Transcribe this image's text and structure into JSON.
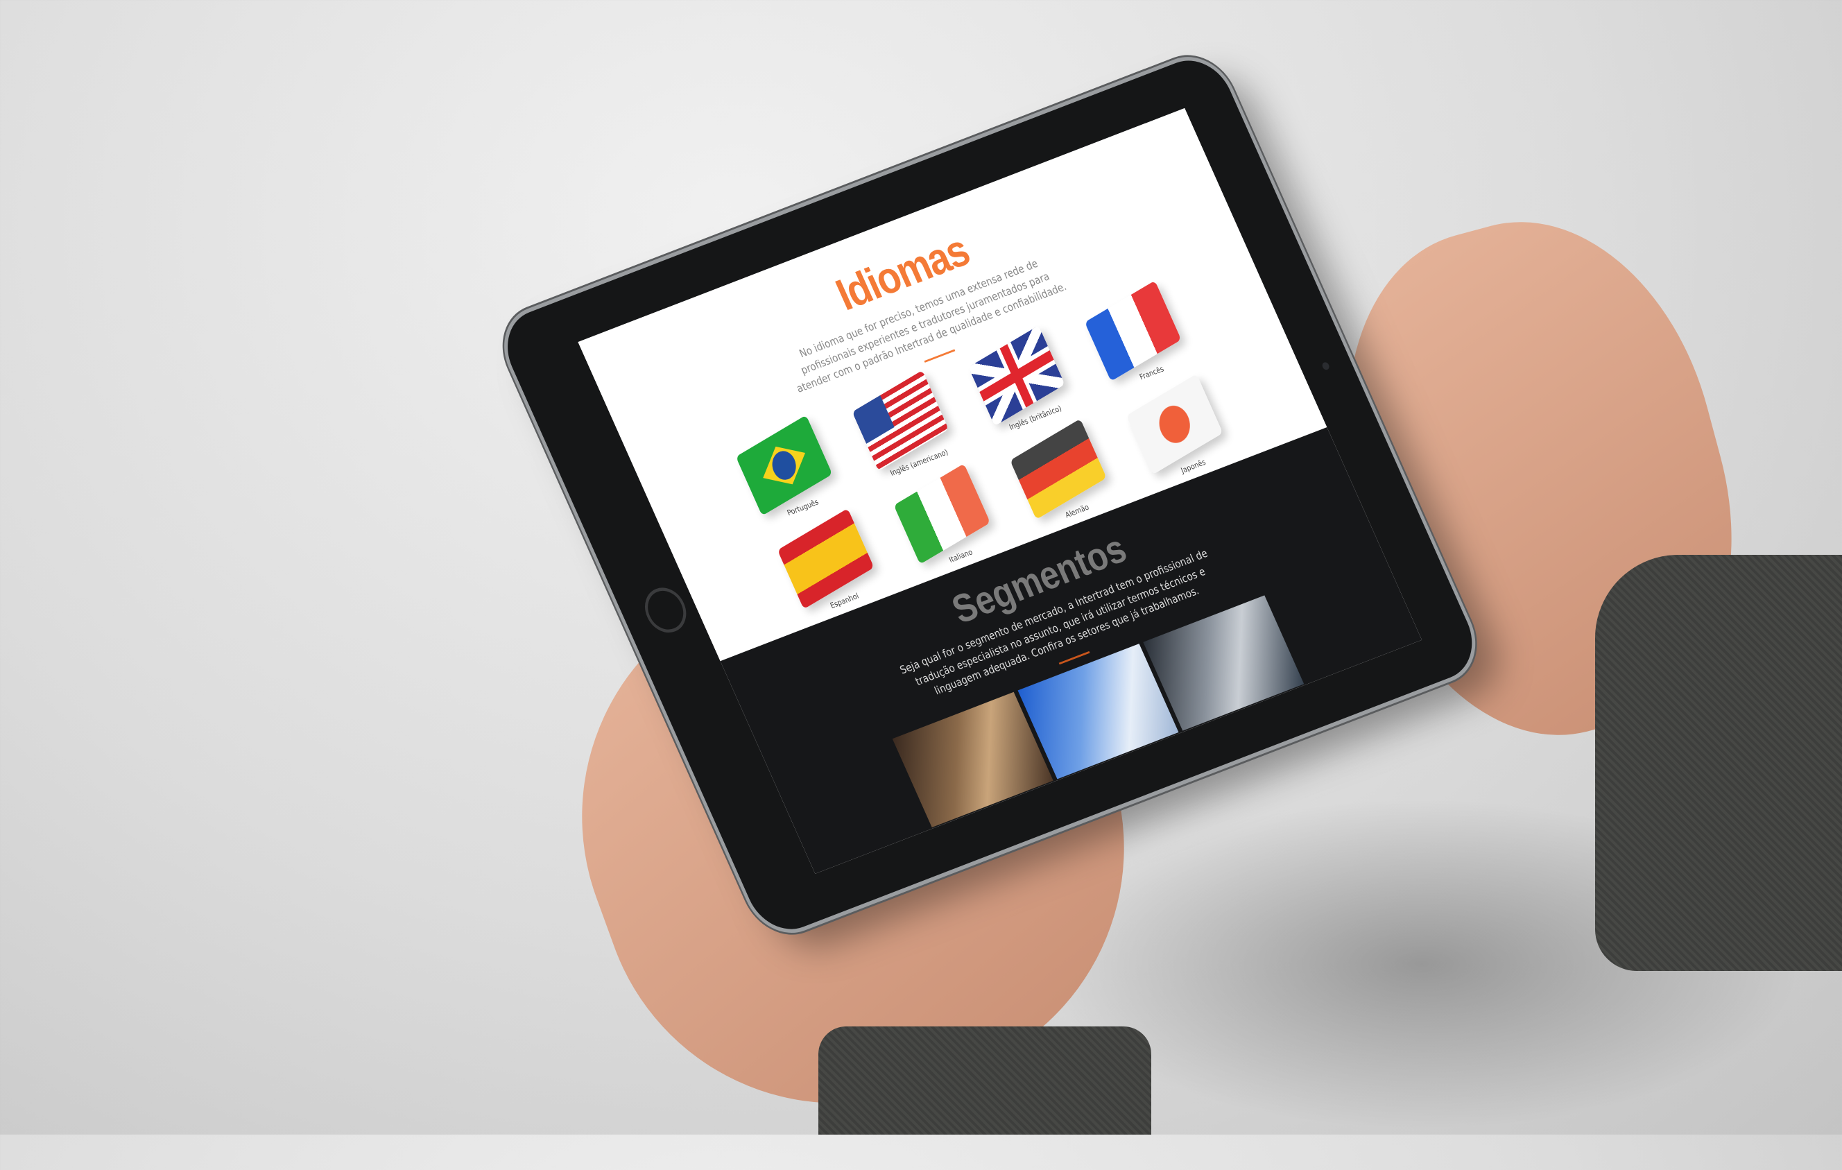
{
  "idiomas": {
    "title": "Idiomas",
    "text": "No idioma que for preciso, temos uma extensa rede de profissionais experientes e tradutores juramentados para atender com o padrão Intertrad de qualidade e confiabilidade.",
    "flags": [
      {
        "label": "Português",
        "icon": "brazil-flag"
      },
      {
        "label": "Inglês (americano)",
        "icon": "usa-flag"
      },
      {
        "label": "Inglês (britânico)",
        "icon": "uk-flag"
      },
      {
        "label": "Francês",
        "icon": "france-flag"
      },
      {
        "label": "Espanhol",
        "icon": "spain-flag"
      },
      {
        "label": "Italiano",
        "icon": "italy-flag"
      },
      {
        "label": "Alemão",
        "icon": "germany-flag"
      },
      {
        "label": "Japonês",
        "icon": "japan-flag"
      }
    ]
  },
  "segmentos": {
    "title": "Segmentos",
    "text": "Seja qual for o segmento de mercado, a Intertrad tem o profissional de tradução especialista no assunto, que irá utilizar termos técnicos e linguagem adequada. Confira os setores que já trabalhamos.",
    "images": [
      "legal-image",
      "laboratory-image",
      "industry-image"
    ]
  },
  "colors": {
    "accent": "#f47a36",
    "dark_bg": "#161719"
  }
}
